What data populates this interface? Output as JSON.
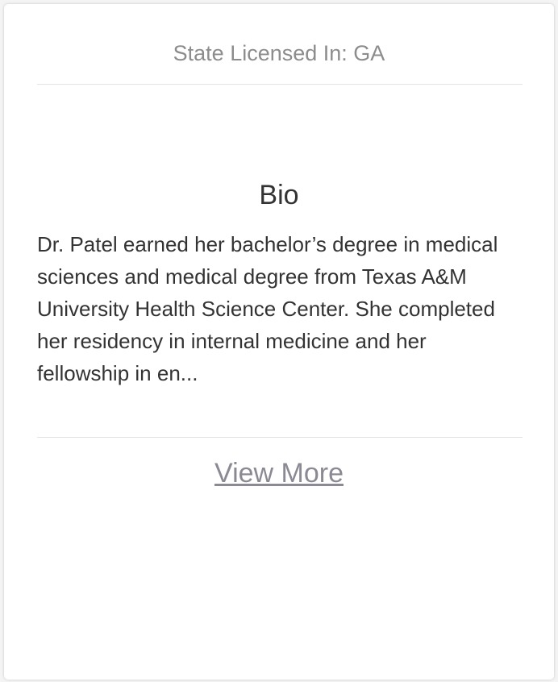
{
  "card": {
    "license_text": "State Licensed In: GA",
    "bio": {
      "title": "Bio",
      "text": "Dr. Patel earned her bachelor’s degree in medical sciences and medical degree from Texas A&M University Health Science Center. She completed her residency in internal medicine and her fellowship in en..."
    },
    "view_more_label": "View More"
  },
  "colors": {
    "card_background": "#ffffff",
    "page_background": "#f4f4f4",
    "muted_text": "#8c8c8c",
    "body_text": "#333333",
    "link": "#8a8a94",
    "divider": "#e3e3e3"
  }
}
